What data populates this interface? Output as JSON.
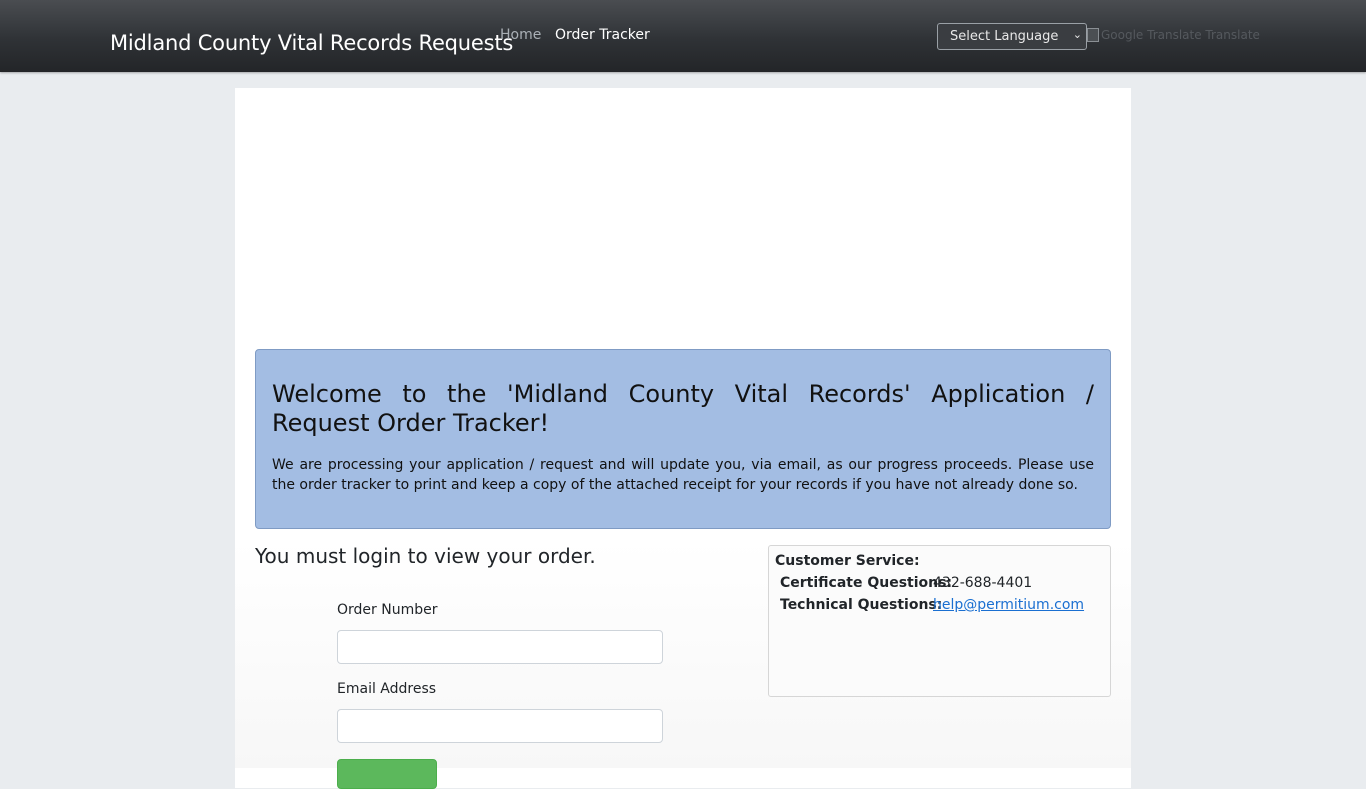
{
  "header": {
    "brand": "Midland County Vital Records Requests",
    "nav": [
      {
        "label": "Home"
      },
      {
        "label": "Order Tracker"
      }
    ],
    "language_select": {
      "selected": "Select Language"
    },
    "translate_alt": "Google Translate Translate"
  },
  "welcome": {
    "heading": "Welcome to the 'Midland County Vital Records' Application / Request Order Tracker!",
    "body": "We are processing your application / request and will update you, via email, as our progress proceeds. Please use the order tracker to print and keep a copy of the attached receipt for your records if you have not already done so."
  },
  "login": {
    "heading": "You must login to view your order.",
    "order_number_label": "Order Number",
    "order_number_value": "",
    "email_label": "Email Address",
    "email_value": ""
  },
  "customer_service": {
    "title": "Customer Service:",
    "rows": [
      {
        "label": "Certificate Questions:",
        "value": "432-688-4401"
      },
      {
        "label": "Technical Questions:",
        "value": "help@permitium.com"
      }
    ]
  },
  "colors": {
    "navbar": "#2f3236",
    "welcome_bg": "#a3bde3",
    "submit": "#5cb85c",
    "link": "#1a6fd1"
  }
}
